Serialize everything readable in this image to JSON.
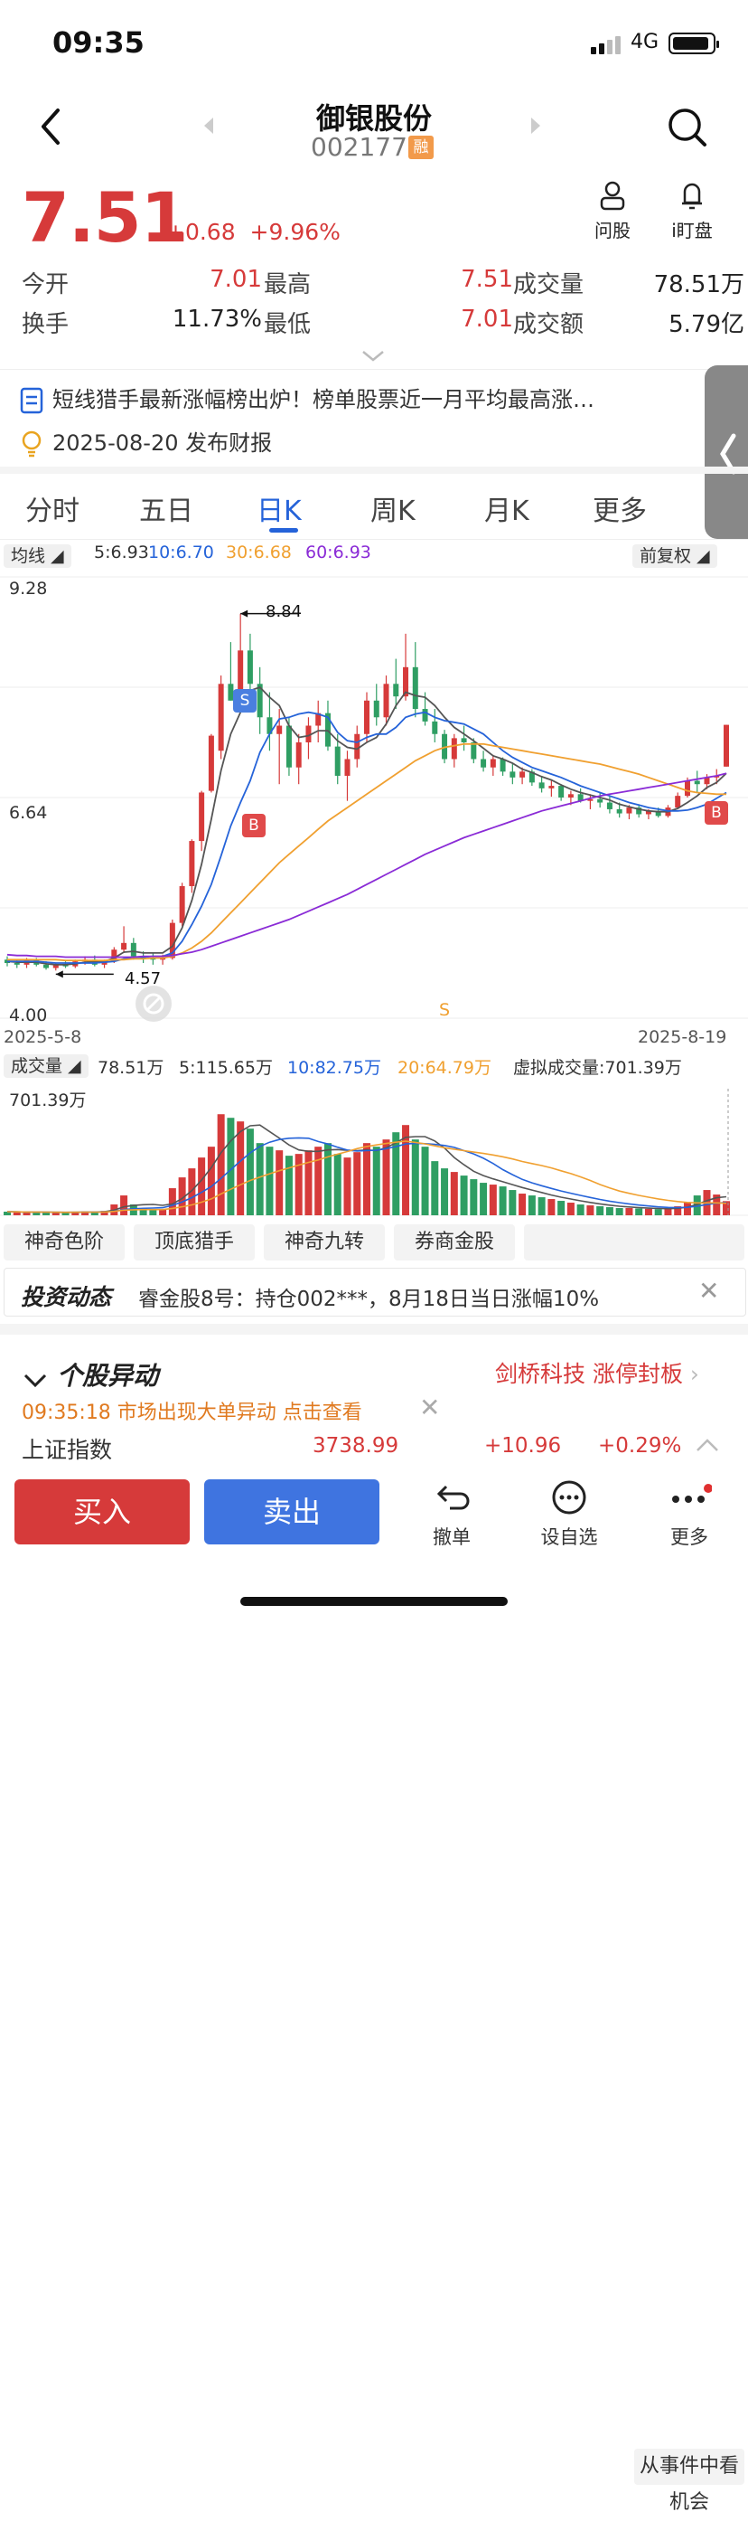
{
  "status_bar": {
    "time": "09:35",
    "network": "4G"
  },
  "header": {
    "title": "御银股份",
    "code": "002177",
    "badge": "融"
  },
  "quote": {
    "price": "7.51",
    "change": "+0.68",
    "change_pct": "+9.96%",
    "open_label": "今开",
    "open": "7.01",
    "high_label": "最高",
    "high": "7.51",
    "volume_label": "成交量",
    "volume": "78.51万",
    "turnover_label": "换手",
    "turnover": "11.73%",
    "low_label": "最低",
    "low": "7.01",
    "amount_label": "成交额",
    "amount": "5.79亿"
  },
  "quick_actions": {
    "ask_label": "问股",
    "watch_label": "i盯盘"
  },
  "news": {
    "headline": "短线猎手最新涨幅榜出炉！榜单股票近一月平均最高涨…",
    "report": "2025-08-20 发布财报"
  },
  "tabs": [
    "分时",
    "五日",
    "日K",
    "周K",
    "月K",
    "更多"
  ],
  "active_tab": "日K",
  "ma_bar": {
    "selector": "均线",
    "ma5": "5:6.93",
    "ma10": "10:6.70",
    "ma30": "30:6.68",
    "ma60": "60:6.93",
    "adjust": "前复权"
  },
  "chart_labels": {
    "top_price": "9.28",
    "mid_price": "6.64",
    "bottom_price": "4.00",
    "peak": "8.84",
    "trough": "4.57",
    "start_date": "2025-5-8",
    "end_date": "2025-8-19",
    "sell_mark": "S",
    "buy_mark": "B",
    "axis_s": "S"
  },
  "volume_bar": {
    "selector": "成交量",
    "vol": "78.51万",
    "ma5": "5:115.65万",
    "ma10": "10:82.75万",
    "ma20": "20:64.79万",
    "virtual": "虚拟成交量:701.39万",
    "top": "701.39万"
  },
  "colors": {
    "up": "#d63a3a",
    "down": "#2f9e63",
    "ma5": "#555555",
    "ma10": "#2563d9",
    "ma30": "#f0a030",
    "ma60": "#8a2bd6"
  },
  "chart_data": {
    "type": "candlestick",
    "ylim": [
      4.0,
      9.28
    ],
    "x_range": [
      "2025-5-8",
      "2025-8-19"
    ],
    "ohlc": [
      [
        4.7,
        4.74,
        4.62,
        4.66
      ],
      [
        4.66,
        4.7,
        4.6,
        4.64
      ],
      [
        4.64,
        4.72,
        4.6,
        4.7
      ],
      [
        4.7,
        4.72,
        4.62,
        4.64
      ],
      [
        4.64,
        4.68,
        4.58,
        4.6
      ],
      [
        4.6,
        4.66,
        4.57,
        4.64
      ],
      [
        4.64,
        4.68,
        4.6,
        4.62
      ],
      [
        4.62,
        4.7,
        4.6,
        4.68
      ],
      [
        4.68,
        4.74,
        4.64,
        4.7
      ],
      [
        4.7,
        4.75,
        4.62,
        4.64
      ],
      [
        4.64,
        4.7,
        4.6,
        4.68
      ],
      [
        4.68,
        4.85,
        4.66,
        4.82
      ],
      [
        4.82,
        5.1,
        4.78,
        4.9
      ],
      [
        4.9,
        4.96,
        4.7,
        4.74
      ],
      [
        4.74,
        4.8,
        4.66,
        4.72
      ],
      [
        4.72,
        4.78,
        4.64,
        4.7
      ],
      [
        4.7,
        4.76,
        4.64,
        4.72
      ],
      [
        4.72,
        5.18,
        4.7,
        5.14
      ],
      [
        5.14,
        5.62,
        5.1,
        5.58
      ],
      [
        5.58,
        6.14,
        5.5,
        6.12
      ],
      [
        6.12,
        6.72,
        6.0,
        6.7
      ],
      [
        6.72,
        7.4,
        6.7,
        7.38
      ],
      [
        7.2,
        8.1,
        7.1,
        8.0
      ],
      [
        8.0,
        8.5,
        7.8,
        7.8
      ],
      [
        7.8,
        8.84,
        7.7,
        8.4
      ],
      [
        8.4,
        8.6,
        7.8,
        8.0
      ],
      [
        8.0,
        8.2,
        7.4,
        7.6
      ],
      [
        7.6,
        7.9,
        7.2,
        7.4
      ],
      [
        7.4,
        7.7,
        6.8,
        7.5
      ],
      [
        7.5,
        7.6,
        6.9,
        7.0
      ],
      [
        7.0,
        7.4,
        6.8,
        7.3
      ],
      [
        7.3,
        7.6,
        7.1,
        7.5
      ],
      [
        7.5,
        7.8,
        7.3,
        7.65
      ],
      [
        7.65,
        7.8,
        7.2,
        7.25
      ],
      [
        7.25,
        7.4,
        6.8,
        6.9
      ],
      [
        6.9,
        7.2,
        6.6,
        7.1
      ],
      [
        7.1,
        7.5,
        7.0,
        7.4
      ],
      [
        7.4,
        7.9,
        7.3,
        7.8
      ],
      [
        7.8,
        8.0,
        7.5,
        7.6
      ],
      [
        7.6,
        8.1,
        7.5,
        8.0
      ],
      [
        8.0,
        8.3,
        7.7,
        7.85
      ],
      [
        7.85,
        8.6,
        7.8,
        8.2
      ],
      [
        8.2,
        8.5,
        7.6,
        7.7
      ],
      [
        7.7,
        7.9,
        7.5,
        7.55
      ],
      [
        7.55,
        7.7,
        7.3,
        7.4
      ],
      [
        7.4,
        7.45,
        7.05,
        7.1
      ],
      [
        7.1,
        7.4,
        7.0,
        7.35
      ],
      [
        7.35,
        7.5,
        7.2,
        7.3
      ],
      [
        7.3,
        7.35,
        7.05,
        7.1
      ],
      [
        7.1,
        7.2,
        6.95,
        7.0
      ],
      [
        7.0,
        7.15,
        6.9,
        7.1
      ],
      [
        7.1,
        7.12,
        6.9,
        6.95
      ],
      [
        6.95,
        7.05,
        6.8,
        6.88
      ],
      [
        6.88,
        7.0,
        6.8,
        6.95
      ],
      [
        6.95,
        6.98,
        6.78,
        6.82
      ],
      [
        6.82,
        6.9,
        6.7,
        6.75
      ],
      [
        6.75,
        6.85,
        6.65,
        6.78
      ],
      [
        6.78,
        6.8,
        6.6,
        6.64
      ],
      [
        6.64,
        6.72,
        6.55,
        6.68
      ],
      [
        6.68,
        6.75,
        6.58,
        6.6
      ],
      [
        6.6,
        6.68,
        6.5,
        6.62
      ],
      [
        6.62,
        6.7,
        6.52,
        6.58
      ],
      [
        6.58,
        6.65,
        6.45,
        6.5
      ],
      [
        6.5,
        6.58,
        6.4,
        6.45
      ],
      [
        6.45,
        6.55,
        6.38,
        6.52
      ],
      [
        6.52,
        6.56,
        6.4,
        6.44
      ],
      [
        6.44,
        6.5,
        6.38,
        6.48
      ],
      [
        6.48,
        6.52,
        6.4,
        6.42
      ],
      [
        6.42,
        6.55,
        6.4,
        6.52
      ],
      [
        6.52,
        6.7,
        6.5,
        6.66
      ],
      [
        6.66,
        6.88,
        6.64,
        6.84
      ],
      [
        6.84,
        6.96,
        6.7,
        6.8
      ],
      [
        6.8,
        6.92,
        6.74,
        6.88
      ],
      [
        6.88,
        6.98,
        6.8,
        6.9
      ],
      [
        7.01,
        7.51,
        7.01,
        7.51
      ]
    ],
    "series": [
      {
        "name": "5",
        "values": [
          4.68,
          4.67,
          4.67,
          4.67,
          4.65,
          4.64,
          4.64,
          4.65,
          4.67,
          4.68,
          4.68,
          4.72,
          4.79,
          4.8,
          4.78,
          4.78,
          4.78,
          4.86,
          5.08,
          5.41,
          5.84,
          6.38,
          6.96,
          7.4,
          7.66,
          7.92,
          7.96,
          7.84,
          7.74,
          7.5,
          7.36,
          7.38,
          7.44,
          7.44,
          7.32,
          7.24,
          7.22,
          7.3,
          7.36,
          7.52,
          7.74,
          7.9,
          7.86,
          7.84,
          7.74,
          7.6,
          7.48,
          7.4,
          7.32,
          7.23,
          7.14,
          7.1,
          7.05,
          6.98,
          6.94,
          6.89,
          6.85,
          6.79,
          6.74,
          6.7,
          6.67,
          6.64,
          6.61,
          6.56,
          6.53,
          6.5,
          6.48,
          6.47,
          6.47,
          6.51,
          6.58,
          6.66,
          6.76,
          6.82,
          6.93
        ]
      },
      {
        "name": "10",
        "values": [
          4.68,
          4.68,
          4.68,
          4.68,
          4.67,
          4.66,
          4.66,
          4.66,
          4.66,
          4.66,
          4.67,
          4.68,
          4.71,
          4.73,
          4.73,
          4.74,
          4.74,
          4.78,
          4.92,
          5.12,
          5.34,
          5.6,
          5.94,
          6.3,
          6.58,
          6.84,
          7.18,
          7.4,
          7.58,
          7.6,
          7.64,
          7.66,
          7.64,
          7.6,
          7.42,
          7.32,
          7.3,
          7.36,
          7.4,
          7.4,
          7.48,
          7.6,
          7.64,
          7.66,
          7.6,
          7.56,
          7.54,
          7.52,
          7.46,
          7.4,
          7.3,
          7.2,
          7.12,
          7.06,
          7.0,
          6.96,
          6.92,
          6.88,
          6.83,
          6.78,
          6.74,
          6.7,
          6.66,
          6.62,
          6.58,
          6.55,
          6.52,
          6.5,
          6.48,
          6.48,
          6.49,
          6.52,
          6.56,
          6.63,
          6.7
        ]
      },
      {
        "name": "30",
        "values": [
          4.7,
          4.7,
          4.7,
          4.7,
          4.7,
          4.7,
          4.69,
          4.69,
          4.69,
          4.69,
          4.69,
          4.7,
          4.7,
          4.71,
          4.71,
          4.72,
          4.72,
          4.74,
          4.78,
          4.84,
          4.92,
          5.02,
          5.14,
          5.26,
          5.38,
          5.5,
          5.62,
          5.74,
          5.86,
          5.96,
          6.06,
          6.16,
          6.26,
          6.36,
          6.44,
          6.52,
          6.6,
          6.68,
          6.76,
          6.84,
          6.92,
          7.0,
          7.08,
          7.14,
          7.2,
          7.24,
          7.26,
          7.28,
          7.28,
          7.28,
          7.26,
          7.24,
          7.22,
          7.2,
          7.18,
          7.16,
          7.14,
          7.12,
          7.1,
          7.08,
          7.06,
          7.04,
          7.01,
          6.98,
          6.95,
          6.92,
          6.88,
          6.84,
          6.8,
          6.76,
          6.72,
          6.7,
          6.69,
          6.68,
          6.68
        ]
      },
      {
        "name": "60",
        "values": [
          4.76,
          4.75,
          4.75,
          4.74,
          4.74,
          4.74,
          4.73,
          4.73,
          4.73,
          4.73,
          4.73,
          4.73,
          4.73,
          4.73,
          4.74,
          4.74,
          4.74,
          4.75,
          4.77,
          4.79,
          4.82,
          4.86,
          4.9,
          4.94,
          4.98,
          5.02,
          5.06,
          5.1,
          5.14,
          5.18,
          5.23,
          5.28,
          5.33,
          5.38,
          5.43,
          5.48,
          5.54,
          5.6,
          5.66,
          5.72,
          5.78,
          5.84,
          5.9,
          5.96,
          6.01,
          6.06,
          6.11,
          6.16,
          6.2,
          6.24,
          6.28,
          6.32,
          6.36,
          6.4,
          6.44,
          6.48,
          6.51,
          6.54,
          6.57,
          6.6,
          6.63,
          6.66,
          6.68,
          6.7,
          6.72,
          6.74,
          6.76,
          6.78,
          6.8,
          6.82,
          6.84,
          6.86,
          6.88,
          6.9,
          6.93
        ]
      }
    ],
    "volume": {
      "ylim": [
        0,
        701.39
      ],
      "values": [
        20,
        18,
        16,
        18,
        15,
        14,
        16,
        18,
        22,
        20,
        24,
        60,
        110,
        60,
        40,
        30,
        35,
        150,
        210,
        260,
        320,
        380,
        560,
        540,
        520,
        480,
        400,
        380,
        360,
        330,
        340,
        360,
        380,
        400,
        340,
        320,
        350,
        400,
        380,
        420,
        460,
        500,
        420,
        380,
        300,
        260,
        240,
        220,
        200,
        180,
        170,
        160,
        140,
        120,
        110,
        100,
        90,
        80,
        70,
        60,
        55,
        50,
        45,
        40,
        40,
        38,
        36,
        34,
        36,
        50,
        70,
        110,
        140,
        115,
        78.51
      ],
      "up": [
        0,
        1,
        1,
        0,
        0,
        1,
        0,
        1,
        1,
        0,
        1,
        1,
        1,
        0,
        0,
        0,
        1,
        1,
        1,
        1,
        1,
        1,
        1,
        0,
        1,
        0,
        0,
        0,
        1,
        0,
        1,
        1,
        1,
        0,
        0,
        1,
        1,
        1,
        0,
        1,
        0,
        1,
        0,
        0,
        0,
        0,
        1,
        0,
        0,
        0,
        1,
        0,
        0,
        1,
        0,
        0,
        1,
        0,
        1,
        0,
        1,
        0,
        0,
        0,
        1,
        0,
        1,
        0,
        1,
        1,
        1,
        0,
        1,
        1,
        1
      ]
    }
  },
  "feature_tags": [
    "神奇色阶",
    "顶底猎手",
    "神奇九转",
    "券商金股",
    "从事件中看机会"
  ],
  "invest_news": {
    "title": "投资动态",
    "text": "睿金股8号：持仓002***，8月18日当日涨幅10%"
  },
  "anomaly": {
    "title": "个股异动",
    "related": "剑桥科技 涨停封板",
    "alert": "09:35:18 市场出现大单异动 点击查看"
  },
  "index": {
    "name": "上证指数",
    "value": "3738.99",
    "change": "+10.96",
    "pct": "+0.29%"
  },
  "toolbar": {
    "buy": "买入",
    "sell": "卖出",
    "cancel": "撤单",
    "watch": "设自选",
    "more": "更多"
  }
}
